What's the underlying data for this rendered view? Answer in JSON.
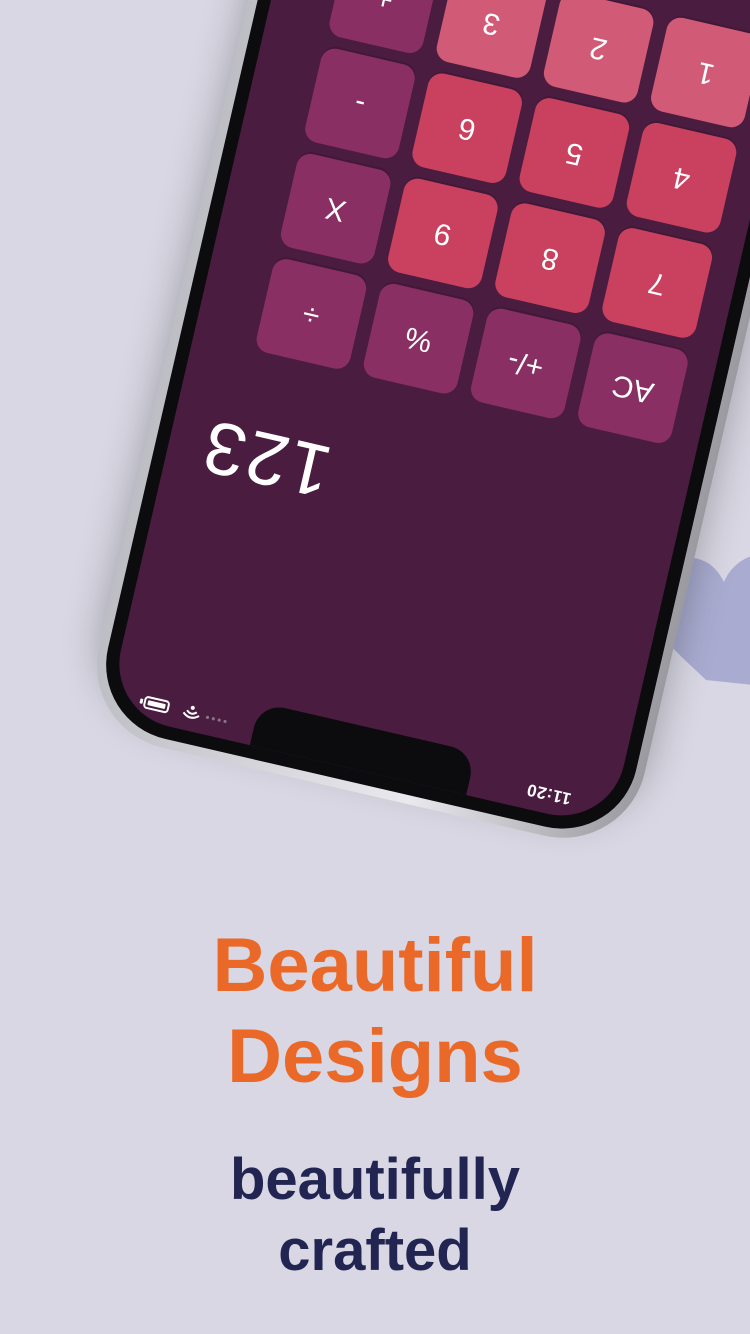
{
  "colors": {
    "background": "#d8d7e3",
    "screen": "#4a1c40",
    "key_function": "#8a2f63",
    "key_number": "#c9415f",
    "key_number_light": "#d15a77",
    "heading": "#ea6928",
    "subheading": "#222551",
    "heart": "#a9abd0"
  },
  "status_bar": {
    "time": "11:20",
    "icons": [
      "signal-icon",
      "wifi-icon",
      "battery-icon"
    ]
  },
  "calculator": {
    "display": "123",
    "keys": [
      {
        "label": "AC",
        "kind": "fn"
      },
      {
        "label": "+/-",
        "kind": "fn"
      },
      {
        "label": "%",
        "kind": "fn"
      },
      {
        "label": "÷",
        "kind": "op"
      },
      {
        "label": "7",
        "kind": "num"
      },
      {
        "label": "8",
        "kind": "num"
      },
      {
        "label": "9",
        "kind": "num"
      },
      {
        "label": "X",
        "kind": "op"
      },
      {
        "label": "4",
        "kind": "num"
      },
      {
        "label": "5",
        "kind": "num"
      },
      {
        "label": "6",
        "kind": "num"
      },
      {
        "label": "-",
        "kind": "op"
      },
      {
        "label": "1",
        "kind": "num-lite"
      },
      {
        "label": "2",
        "kind": "num-lite"
      },
      {
        "label": "3",
        "kind": "num-lite"
      },
      {
        "label": "+",
        "kind": "op"
      }
    ]
  },
  "headline": {
    "line1": "Beautiful",
    "line2": "Designs"
  },
  "subheadline": {
    "line1": "beautifully",
    "line2": "crafted"
  }
}
